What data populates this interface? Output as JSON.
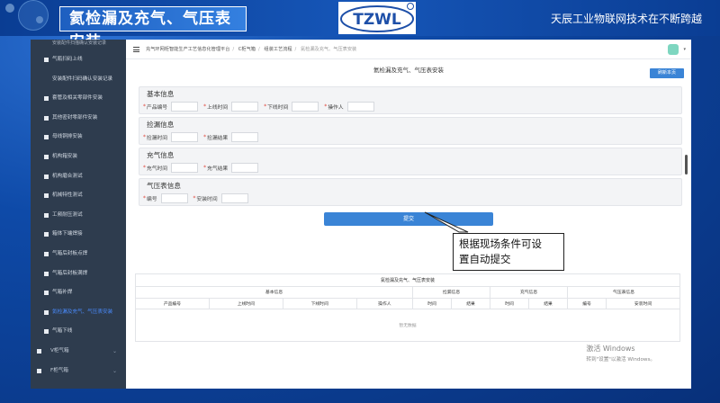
{
  "slide": {
    "title": "氦检漏及充气、气压表安装",
    "logo_text": "TZWL",
    "tagline": "天辰工业物联网技术在不断跨越"
  },
  "sidebar": {
    "top_text": "安装配件扫描确认安装记录",
    "items": [
      {
        "label": "气瓶扫码上线",
        "icon": true
      },
      {
        "label": "安装配件扫码确认安装记录",
        "icon": false
      },
      {
        "label": "套管及相关零部件安装",
        "icon": true
      },
      {
        "label": "其他密封零部件安装",
        "icon": true
      },
      {
        "label": "母线铜排安装",
        "icon": true
      },
      {
        "label": "机构箱安装",
        "icon": true
      },
      {
        "label": "机构磨合测试",
        "icon": true
      },
      {
        "label": "机械特性测试",
        "icon": true
      },
      {
        "label": "工频耐压测试",
        "icon": true
      },
      {
        "label": "箱体下端焊接",
        "icon": true
      },
      {
        "label": "气箱后封板点焊",
        "icon": true
      },
      {
        "label": "气箱后封板满焊",
        "icon": true
      },
      {
        "label": "气箱补焊",
        "icon": true
      },
      {
        "label": "氦检漏及充气、气压表安装",
        "icon": true,
        "active": true
      },
      {
        "label": "气箱下线",
        "icon": true
      }
    ],
    "groups": [
      {
        "label": "V柜气箱"
      },
      {
        "label": "F柜气箱"
      }
    ]
  },
  "topbar": {
    "crumbs": [
      "充气环网柜智能生产工艺信息化管理平台",
      "C柜气箱",
      "组装工艺流程"
    ],
    "current": "氦检漏及充气、气压表安装"
  },
  "form": {
    "title": "氦检漏及充气、气压表安装",
    "refresh_label": "刷新本页",
    "sections": [
      {
        "title": "基本信息",
        "fields": [
          "产品编号",
          "上线时间",
          "下线时间",
          "操作人"
        ]
      },
      {
        "title": "捡漏信息",
        "fields": [
          "捡漏时间",
          "捡漏结果"
        ]
      },
      {
        "title": "充气信息",
        "fields": [
          "充气时间",
          "充气结果"
        ]
      },
      {
        "title": "气压表信息",
        "fields": [
          "编号",
          "安装时间"
        ]
      }
    ],
    "submit_label": "提交"
  },
  "table": {
    "title": "氦检漏及充气、气压表安装",
    "groups": [
      "基本信息",
      "捡漏信息",
      "充气信息",
      "气压表信息"
    ],
    "columns": [
      "产品编号",
      "上线时间",
      "下线时间",
      "操作人",
      "时间",
      "结果",
      "时间",
      "结果",
      "编号",
      "安装时间"
    ],
    "empty_text": "暂无数据"
  },
  "callout": {
    "line1": "根据现场条件可设",
    "line2": "置自动提交"
  },
  "watermark": {
    "line1": "激活 Windows",
    "line2": "转到\"设置\"以激活 Windows。"
  },
  "colors": {
    "primary": "#3a84d6",
    "sidebar_bg": "#2e3c4e",
    "active": "#4a8cff",
    "required": "#e0463b"
  }
}
